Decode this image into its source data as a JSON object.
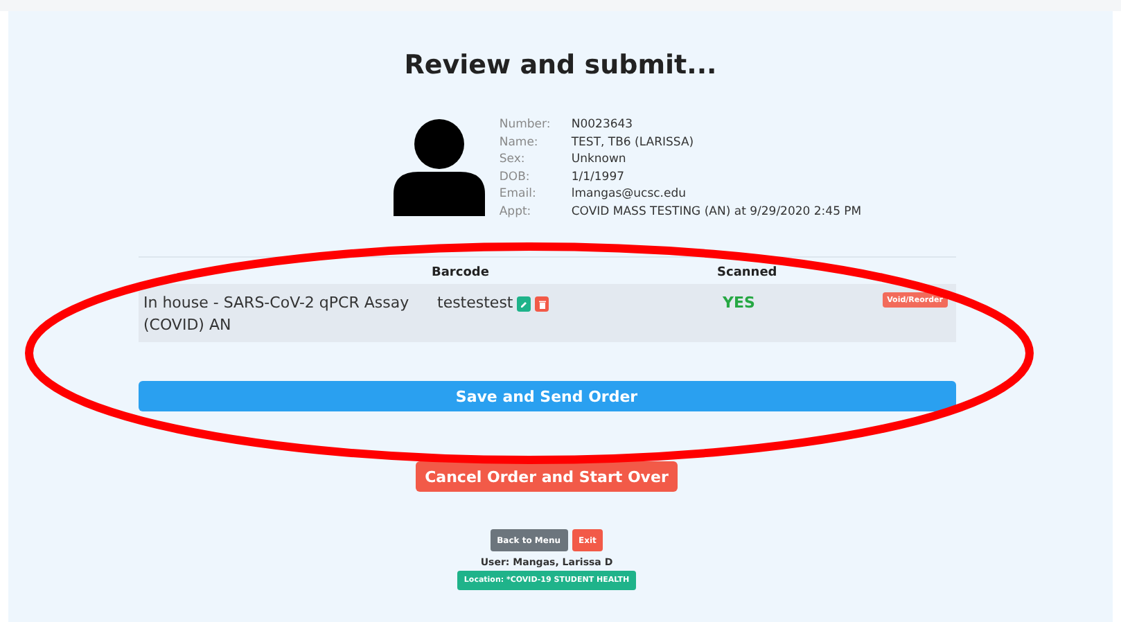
{
  "title": "Review and submit...",
  "patient": [
    {
      "label": "Number:",
      "value": "N0023643"
    },
    {
      "label": "Name:",
      "value": "TEST, TB6 (LARISSA)"
    },
    {
      "label": "Sex:",
      "value": "Unknown"
    },
    {
      "label": "DOB:",
      "value": "1/1/1997"
    },
    {
      "label": "Email:",
      "value": "lmangas@ucsc.edu"
    },
    {
      "label": "Appt:",
      "value": "COVID MASS TESTING (AN) at 9/29/2020 2:45 PM"
    }
  ],
  "table": {
    "columns": [
      "Barcode",
      "Scanned"
    ],
    "rows": [
      {
        "test": "In house - SARS-CoV-2 qPCR Assay (COVID) AN",
        "barcode": "testestest",
        "scanned": "YES",
        "action": "Void/Reorder"
      }
    ]
  },
  "save_button": "Save and Send Order",
  "cancel_button": "Cancel Order and Start Over",
  "back_button": "Back to Menu",
  "exit_button": "Exit",
  "user": "User: Mangas, Larissa D",
  "location": "Location: *COVID-19 STUDENT HEALTH"
}
